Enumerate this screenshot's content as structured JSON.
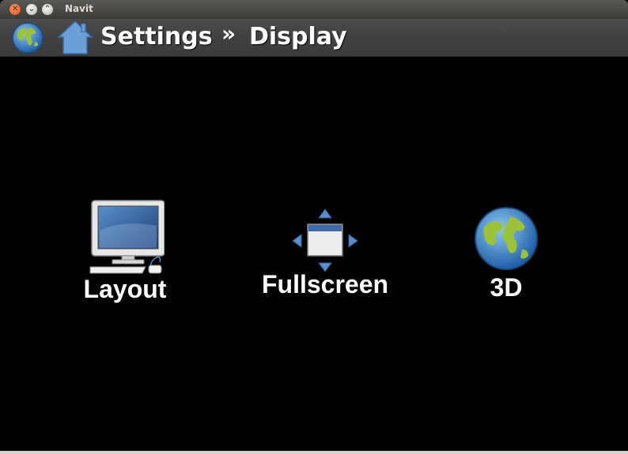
{
  "window": {
    "title": "Navit"
  },
  "toolbar": {
    "breadcrumb": [
      "Settings",
      "Display"
    ],
    "separator": "»"
  },
  "items": [
    {
      "label": "Layout",
      "icon": "computer-monitor-icon"
    },
    {
      "label": "Fullscreen",
      "icon": "fullscreen-window-icon"
    },
    {
      "label": "3D",
      "icon": "globe-icon"
    }
  ]
}
